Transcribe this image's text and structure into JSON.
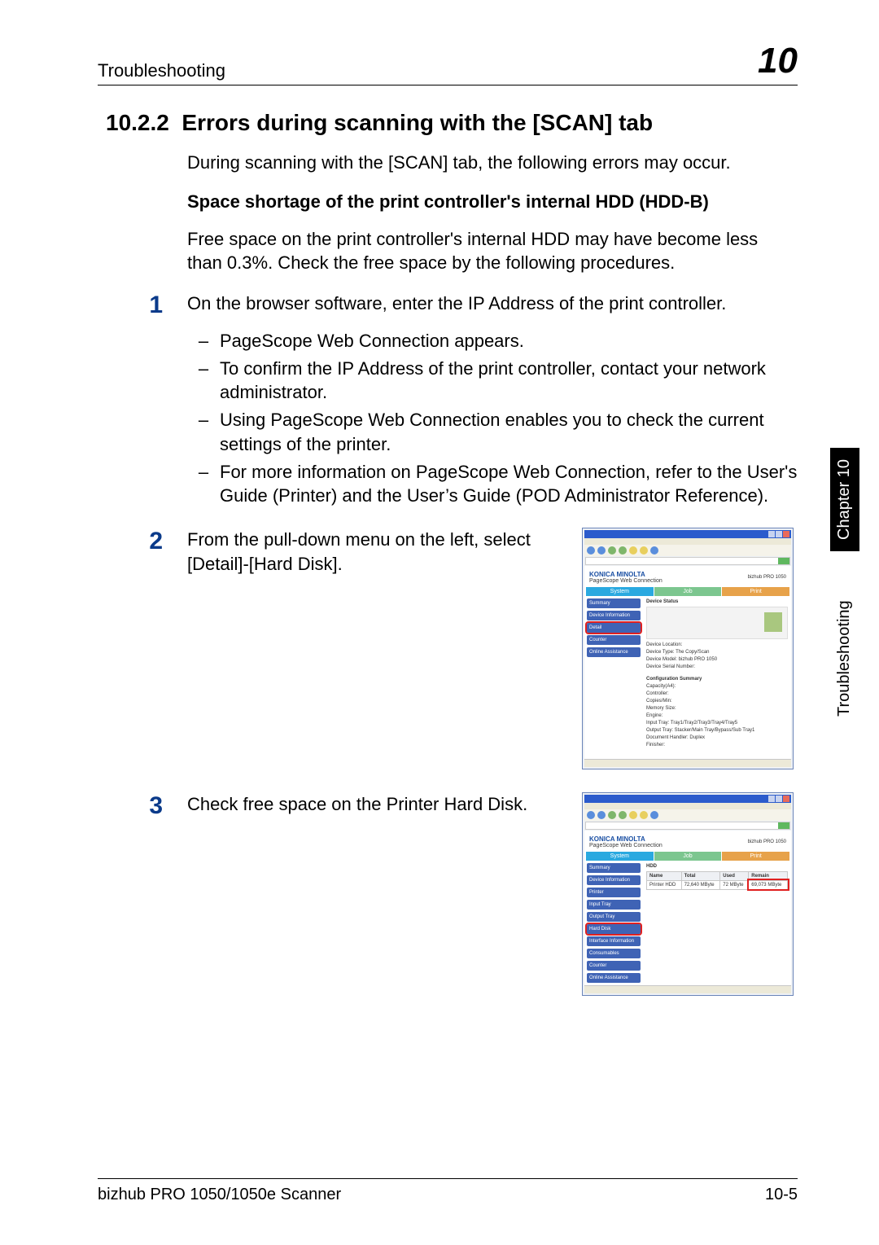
{
  "header": {
    "left": "Troubleshooting",
    "right": "10"
  },
  "side_tab": {
    "black": "Chapter 10",
    "white": "Troubleshooting"
  },
  "section": {
    "number": "10.2.2",
    "title": "Errors during scanning with the [SCAN] tab",
    "intro": "During scanning with the [SCAN] tab, the following errors may occur.",
    "subheading": "Space shortage of the print controller's internal HDD (HDD-B)",
    "subintro": "Free space on the print controller's internal HDD may have become less than 0.3%. Check the free space by the following procedures."
  },
  "steps": {
    "s1": {
      "num": "1",
      "text": "On the browser software, enter the IP Address of the print controller.",
      "bullets": [
        "PageScope Web Connection appears.",
        "To confirm the IP Address of the print controller, contact your network administrator.",
        "Using PageScope Web Connection enables you to check the current settings of the printer.",
        "For more information on PageScope Web Connection, refer to the User's Guide (Printer) and the User’s Guide (POD Administrator Reference)."
      ]
    },
    "s2": {
      "num": "2",
      "text": "From the pull-down menu on the left, select [Detail]-[Hard Disk]."
    },
    "s3": {
      "num": "3",
      "text": "Check free space on the Printer Hard Disk."
    }
  },
  "screenshot_common": {
    "brand": "KONICA MINOLTA",
    "pwc": "PageScope Web Connection",
    "model_label": "bizhub PRO 1050",
    "tab_system": "System",
    "tab_job": "Job",
    "tab_print": "Print"
  },
  "screenshot1": {
    "nav": [
      "Summary",
      "Device Information",
      "Detail",
      "Counter",
      "Online Assistance"
    ],
    "selected": "Detail",
    "panel_title": "Device Status",
    "kv": [
      "Device Location:",
      "Device Type: The Copy/Scan",
      "Device Model: bizhub PRO 1050",
      "Device Serial Number:",
      "Configuration Summary",
      "Capacity(A4):",
      "Controller:",
      "Copies/Min:",
      "Memory Size:",
      "Engine:",
      "Input Tray: Tray1/Tray2/Tray3/Tray4/Tray5",
      "Output Tray: Stacker/Main Tray/Bypass/Sub Tray1",
      "Document Handler: Duplex",
      "Finisher:"
    ]
  },
  "screenshot2": {
    "nav": [
      "Summary",
      "Device Information",
      "Printer",
      "Input Tray",
      "Output Tray",
      "Hard Disk",
      "Interface Information",
      "Consumables",
      "Counter",
      "Online Assistance"
    ],
    "selected": "Hard Disk",
    "table": {
      "title": "HDD",
      "cols": [
        "Name",
        "Total",
        "Used",
        "Remain"
      ],
      "row": [
        "Printer HDD",
        "72,640 MByte",
        "72 MByte",
        "69,073 MByte"
      ]
    }
  },
  "footer": {
    "left": "bizhub PRO 1050/1050e Scanner",
    "right": "10-5"
  }
}
